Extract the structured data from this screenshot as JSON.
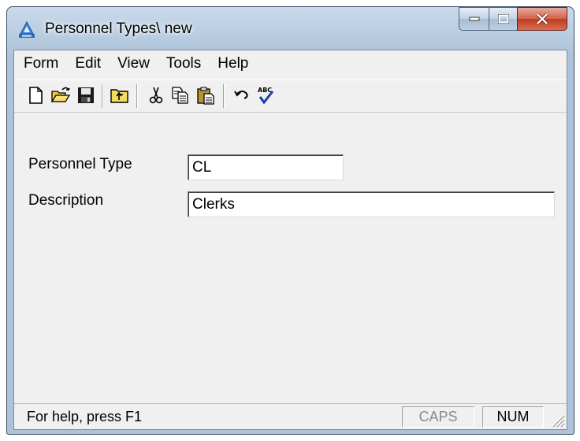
{
  "window": {
    "title": "Personnel Types\\ new"
  },
  "menu": [
    "Form",
    "Edit",
    "View",
    "Tools",
    "Help"
  ],
  "toolbar": {
    "buttons": [
      "new-icon",
      "open-icon",
      "save-icon",
      "up-folder-icon",
      "cut-icon",
      "copy-icon",
      "paste-icon",
      "undo-icon",
      "spellcheck-icon"
    ]
  },
  "form": {
    "personnel_type_label": "Personnel Type",
    "personnel_type_value": "CL",
    "description_label": "Description",
    "description_value": "Clerks"
  },
  "status": {
    "help_text": "For help, press F1",
    "caps": "CAPS",
    "num": "NUM"
  },
  "colors": {
    "titlebar": "#b7cbe0",
    "close_button": "#c03b21",
    "client_bg": "#f0f0f0",
    "caps_inactive": "#8a8a8a"
  }
}
